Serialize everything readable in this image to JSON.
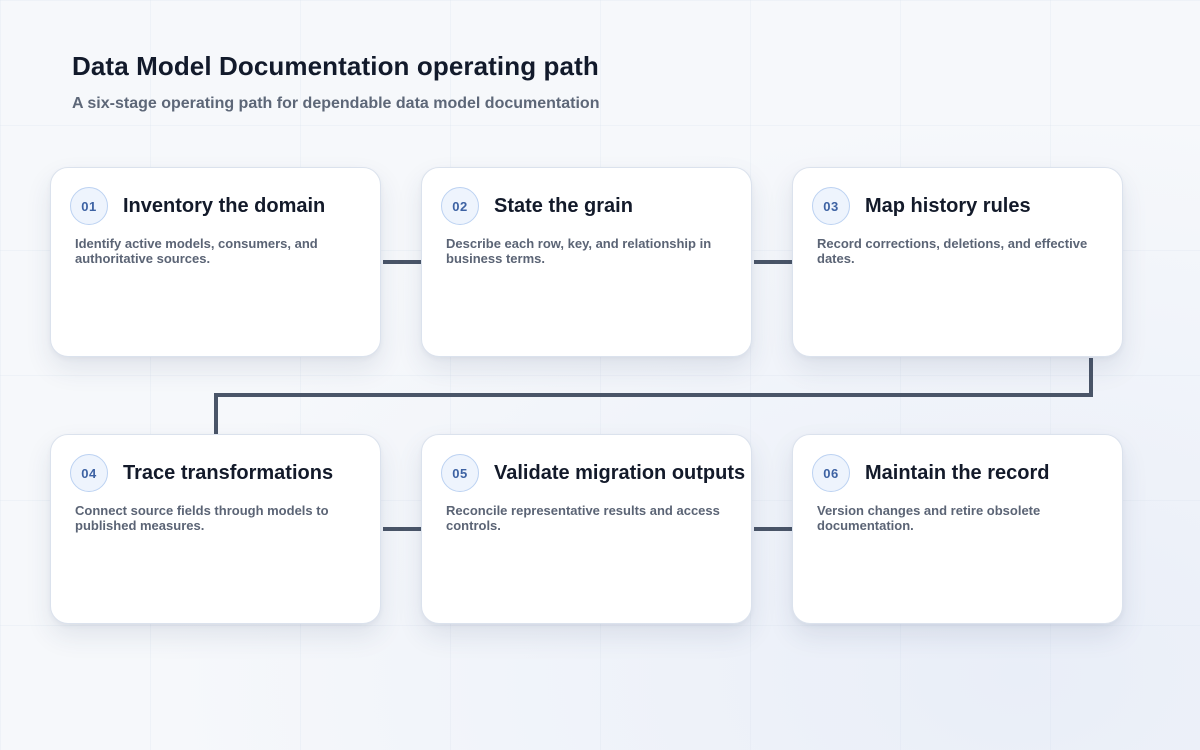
{
  "header": {
    "title": "Data Model Documentation operating path",
    "subtitle": "A six-stage operating path for dependable data model documentation"
  },
  "stages": [
    {
      "number": "01",
      "title": "Inventory the domain",
      "description": "Identify active models, consumers, and authoritative sources."
    },
    {
      "number": "02",
      "title": "State the grain",
      "description": "Describe each row, key, and relationship in business terms."
    },
    {
      "number": "03",
      "title": "Map history rules",
      "description": "Record corrections, deletions, and effective dates."
    },
    {
      "number": "04",
      "title": "Trace transformations",
      "description": "Connect source fields through models to published measures."
    },
    {
      "number": "05",
      "title": "Validate migration outputs",
      "description": "Reconcile representative results and access controls."
    },
    {
      "number": "06",
      "title": "Maintain the record",
      "description": "Version changes and retire obsolete documentation."
    }
  ],
  "colors": {
    "connector": "#4a5568",
    "badge_text": "#3d62a3",
    "title_text": "#131a2a",
    "body_text": "#5b6475"
  }
}
